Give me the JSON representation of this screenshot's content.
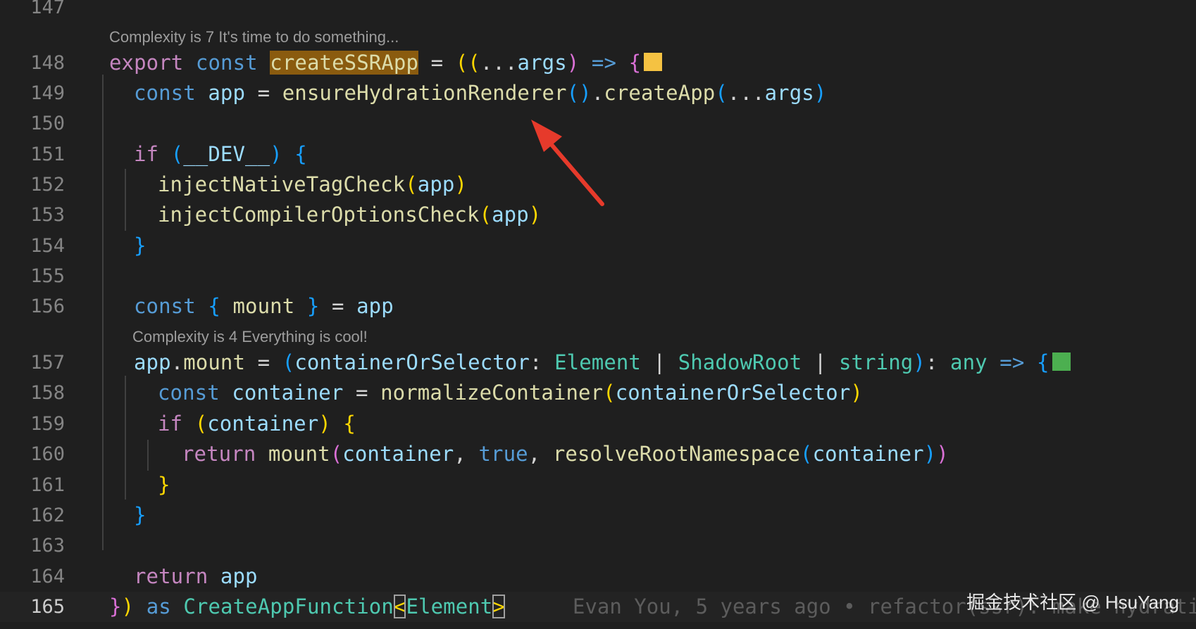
{
  "codelens": {
    "first": "Complexity is 7 It's time to do something...",
    "second": "Complexity is 4 Everything is cool!"
  },
  "line_numbers": [
    "147",
    "148",
    "149",
    "150",
    "151",
    "152",
    "153",
    "154",
    "155",
    "156",
    "157",
    "158",
    "159",
    "160",
    "161",
    "162",
    "163",
    "164",
    "165"
  ],
  "blame": "Evan You, 5 years ago • refactor(ssr): make hydrati",
  "watermark": "掘金技术社区 @ HsuYang",
  "complexity_colors": {
    "high": "#f5c242",
    "low": "#4caf50"
  },
  "code": {
    "l148": {
      "export": "export",
      "const": "const",
      "name": "createSSRApp",
      "eq": " = ",
      "open": "((",
      "spread": "...",
      "args": "args",
      "close1": ")",
      "arrow": " => ",
      "brace": "{"
    },
    "l149": {
      "const": "const",
      "app": "app",
      "eq": " = ",
      "fn": "ensureHydrationRenderer",
      "call": "()",
      "dot": ".",
      "fn2": "createApp",
      "op": "(",
      "spread": "...",
      "args": "args",
      "cp": ")"
    },
    "l151": {
      "if": "if",
      "op": "(",
      "dev": "__DEV__",
      "cp": ")",
      "brace": "{"
    },
    "l152": {
      "fn": "injectNativeTagCheck",
      "op": "(",
      "arg": "app",
      "cp": ")"
    },
    "l153": {
      "fn": "injectCompilerOptionsCheck",
      "op": "(",
      "arg": "app",
      "cp": ")"
    },
    "l154": {
      "brace": "}"
    },
    "l156": {
      "const": "const",
      "ob": "{",
      "mount": "mount",
      "cb": "}",
      "eq": " = ",
      "app": "app"
    },
    "l157": {
      "app": "app",
      "dot": ".",
      "mount": "mount",
      "eq": " = ",
      "op": "(",
      "param": "containerOrSelector",
      "colon": ": ",
      "t1": "Element",
      "bar1": " | ",
      "t2": "ShadowRoot",
      "bar2": " | ",
      "t3": "string",
      "cp": ")",
      "colon2": ": ",
      "any": "any",
      "arrow": " => ",
      "brace": "{"
    },
    "l158": {
      "const": "const",
      "var": "container",
      "eq": " = ",
      "fn": "normalizeContainer",
      "op": "(",
      "arg": "containerOrSelector",
      "cp": ")"
    },
    "l159": {
      "if": "if",
      "op": "(",
      "arg": "container",
      "cp": ")",
      "brace": "{"
    },
    "l160": {
      "ret": "return",
      "fn": "mount",
      "op": "(",
      "a1": "container",
      "comma1": ", ",
      "a2": "true",
      "comma2": ", ",
      "fn2": "resolveRootNamespace",
      "op2": "(",
      "a3": "container",
      "cp2": ")",
      "cp": ")"
    },
    "l161": {
      "brace": "}"
    },
    "l162": {
      "brace": "}"
    },
    "l164": {
      "ret": "return",
      "app": "app"
    },
    "l165": {
      "cb": "}",
      "cp": ")",
      "as": "as",
      "type": "CreateAppFunction",
      "lt": "<",
      "el": "Element",
      "gt": ">"
    }
  }
}
